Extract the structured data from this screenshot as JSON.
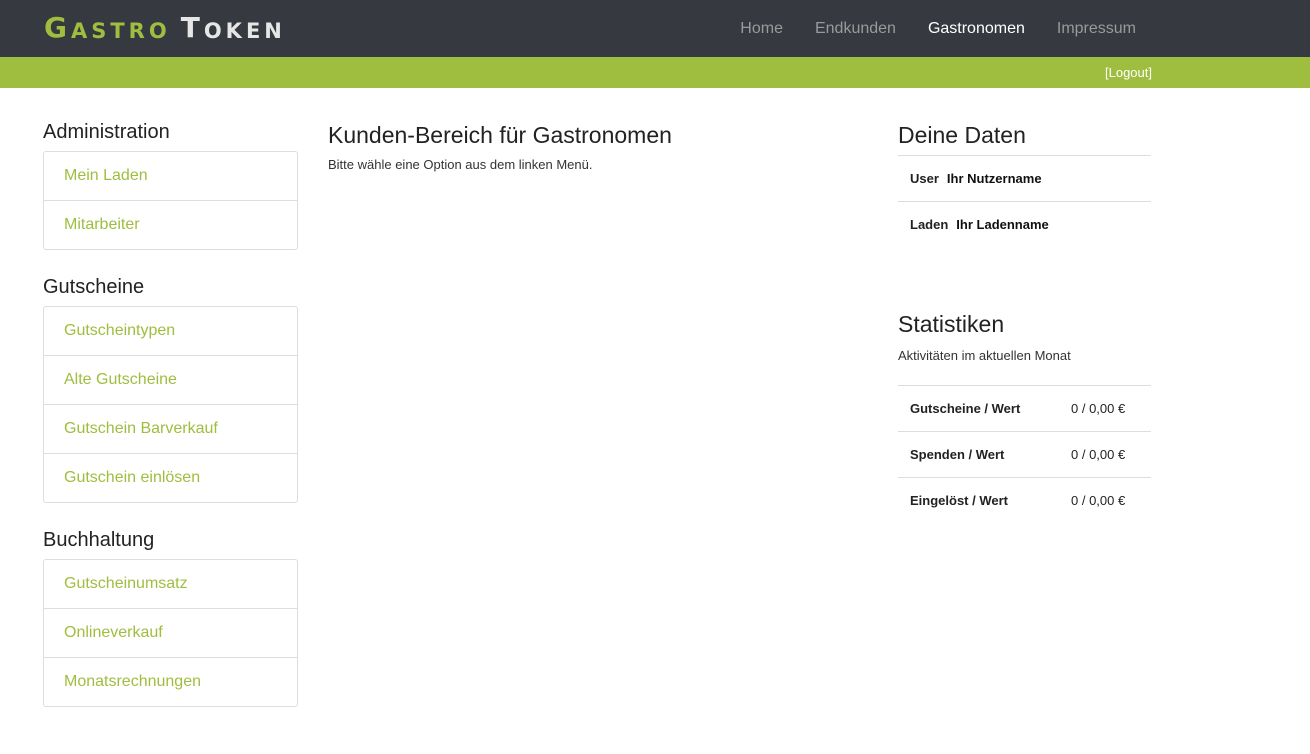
{
  "brand": {
    "part1_first": "G",
    "part1_rest": "ASTRO",
    "part2_first": "T",
    "part2_rest": "OKEN"
  },
  "nav": {
    "items": [
      "Home",
      "Endkunden",
      "Gastronomen",
      "Impressum"
    ],
    "active": "Gastronomen"
  },
  "subbar": {
    "logout": "[Logout]"
  },
  "colors": {
    "accent": "#9fbe3f",
    "navbar": "#363940"
  },
  "sidebar": {
    "sections": [
      {
        "title": "Administration",
        "items": [
          "Mein Laden",
          "Mitarbeiter"
        ]
      },
      {
        "title": "Gutscheine",
        "items": [
          "Gutscheintypen",
          "Alte Gutscheine",
          "Gutschein Barverkauf",
          "Gutschein einlösen"
        ]
      },
      {
        "title": "Buchhaltung",
        "items": [
          "Gutscheinumsatz",
          "Onlineverkauf",
          "Monatsrechnungen"
        ]
      }
    ]
  },
  "main": {
    "title": "Kunden-Bereich für Gastronomen",
    "text": "Bitte wähle eine Option aus dem linken Menü."
  },
  "user_data": {
    "title": "Deine Daten",
    "rows": [
      {
        "label": "User",
        "value": "Ihr Nutzername"
      },
      {
        "label": "Laden",
        "value": "Ihr Ladenname"
      }
    ]
  },
  "statistics": {
    "title": "Statistiken",
    "subtitle": "Aktivitäten im aktuellen Monat",
    "rows": [
      {
        "label": "Gutscheine / Wert",
        "value": "0 / 0,00 €"
      },
      {
        "label": "Spenden / Wert",
        "value": "0 / 0,00 €"
      },
      {
        "label": "Eingelöst / Wert",
        "value": "0 / 0,00 €"
      }
    ]
  }
}
